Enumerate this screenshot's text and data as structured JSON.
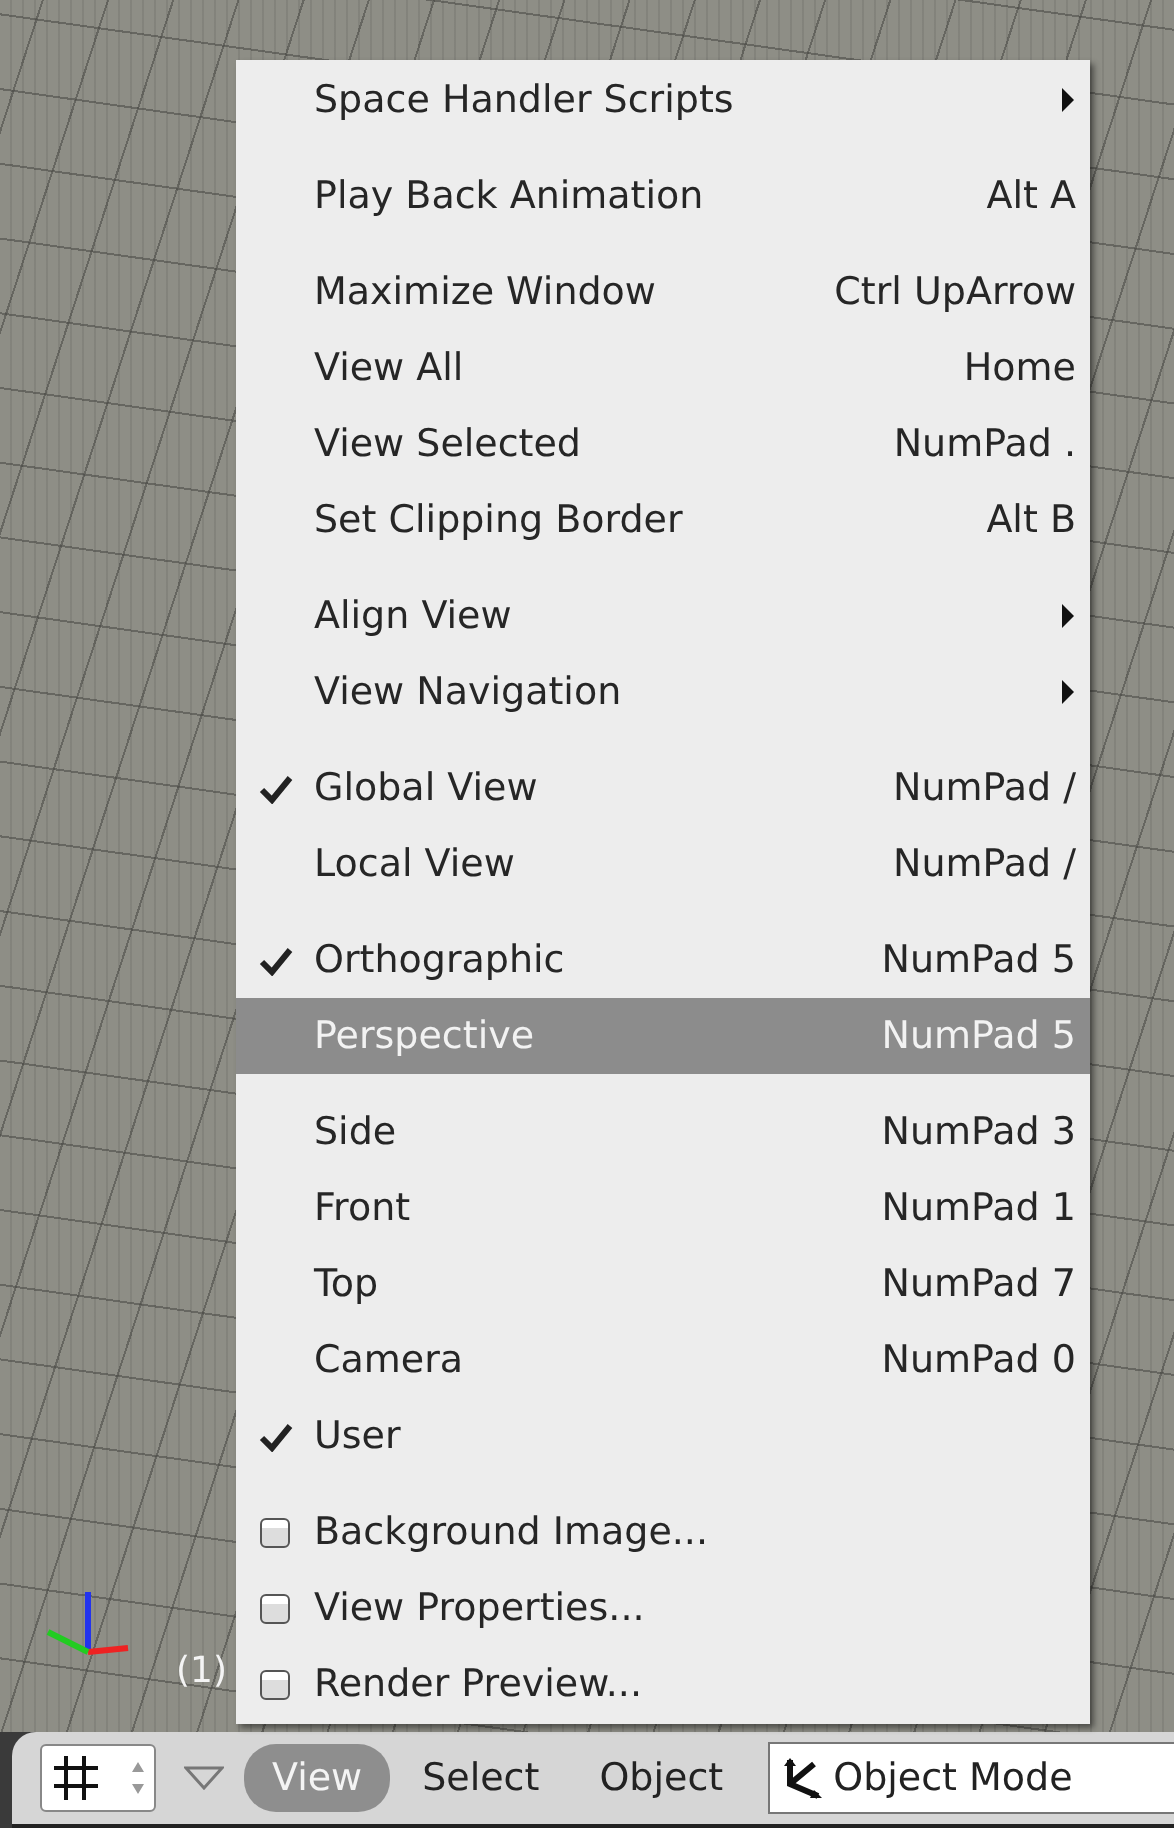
{
  "viewport": {
    "frame_label": "(1)"
  },
  "menu": {
    "groups": [
      [
        {
          "label": "Space Handler Scripts",
          "kind": "submenu",
          "selected": false
        }
      ],
      [
        {
          "label": "Play Back Animation",
          "kind": "command",
          "shortcut": "Alt A",
          "selected": false
        }
      ],
      [
        {
          "label": "Maximize Window",
          "kind": "command",
          "shortcut": "Ctrl UpArrow",
          "selected": false
        },
        {
          "label": "View All",
          "kind": "command",
          "shortcut": "Home",
          "selected": false
        },
        {
          "label": "View Selected",
          "kind": "command",
          "shortcut": "NumPad .",
          "selected": false
        },
        {
          "label": "Set Clipping Border",
          "kind": "command",
          "shortcut": "Alt B",
          "selected": false
        }
      ],
      [
        {
          "label": "Align View",
          "kind": "submenu",
          "selected": false
        },
        {
          "label": "View Navigation",
          "kind": "submenu",
          "selected": false
        }
      ],
      [
        {
          "label": "Global View",
          "kind": "option",
          "shortcut": "NumPad /",
          "checked": true,
          "selected": false
        },
        {
          "label": "Local View",
          "kind": "option",
          "shortcut": "NumPad /",
          "checked": false,
          "selected": false
        }
      ],
      [
        {
          "label": "Orthographic",
          "kind": "option",
          "shortcut": "NumPad 5",
          "checked": true,
          "selected": false
        },
        {
          "label": "Perspective",
          "kind": "option",
          "shortcut": "NumPad 5",
          "checked": false,
          "selected": true
        }
      ],
      [
        {
          "label": "Side",
          "kind": "option",
          "shortcut": "NumPad 3",
          "checked": false,
          "selected": false
        },
        {
          "label": "Front",
          "kind": "option",
          "shortcut": "NumPad 1",
          "checked": false,
          "selected": false
        },
        {
          "label": "Top",
          "kind": "option",
          "shortcut": "NumPad 7",
          "checked": false,
          "selected": false
        },
        {
          "label": "Camera",
          "kind": "option",
          "shortcut": "NumPad 0",
          "checked": false,
          "selected": false
        },
        {
          "label": "User",
          "kind": "option",
          "checked": true,
          "selected": false
        }
      ],
      [
        {
          "label": "Background Image...",
          "kind": "checkbox",
          "checked": false,
          "selected": false
        },
        {
          "label": "View Properties...",
          "kind": "checkbox",
          "checked": false,
          "selected": false
        },
        {
          "label": "Render Preview...",
          "kind": "checkbox",
          "checked": false,
          "selected": false
        }
      ]
    ]
  },
  "header": {
    "menus": [
      {
        "label": "View",
        "selected": true
      },
      {
        "label": "Select",
        "selected": false
      },
      {
        "label": "Object",
        "selected": false
      }
    ],
    "mode": {
      "label": "Object Mode"
    }
  }
}
